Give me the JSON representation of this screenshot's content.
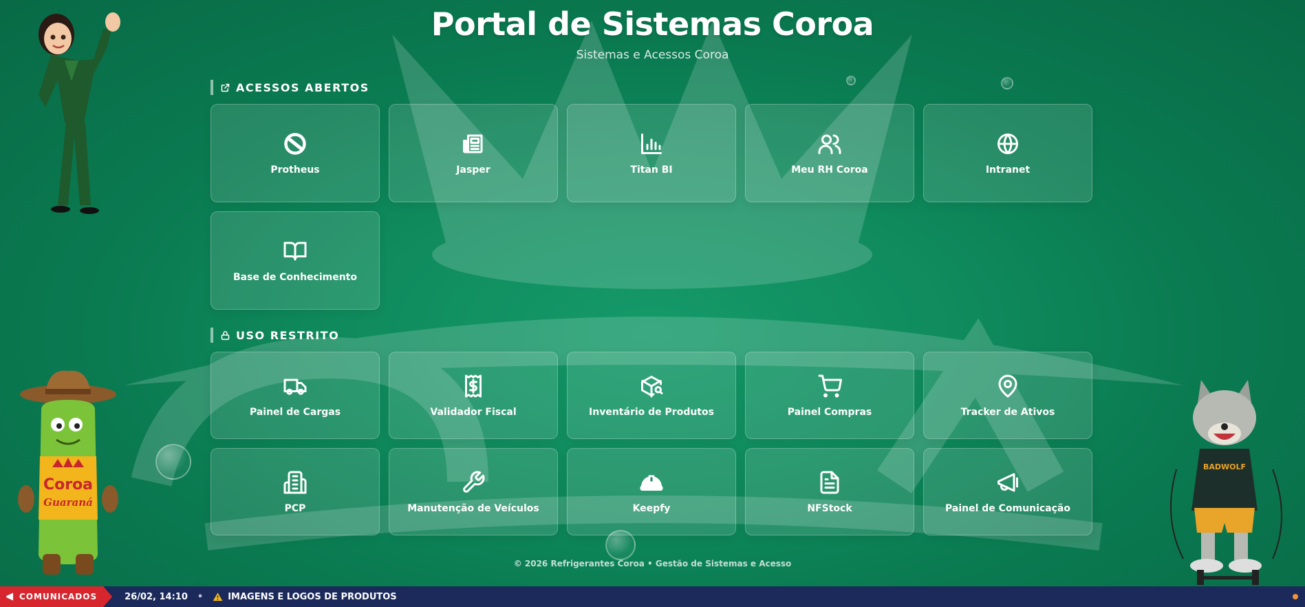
{
  "header": {
    "title": "Portal de Sistemas Coroa",
    "subtitle": "Sistemas e Acessos Coroa"
  },
  "sections": {
    "open": {
      "title": "ACESSOS ABERTOS",
      "icon": "external-link-icon",
      "items": [
        {
          "label": "Protheus",
          "icon": "protheus-logo-icon"
        },
        {
          "label": "Jasper",
          "icon": "newspaper-icon"
        },
        {
          "label": "Titan BI",
          "icon": "bar-chart-icon"
        },
        {
          "label": "Meu RH Coroa",
          "icon": "users-icon"
        },
        {
          "label": "Intranet",
          "icon": "globe-icon"
        },
        {
          "label": "Base de Conhecimento",
          "icon": "book-open-icon"
        }
      ]
    },
    "restricted": {
      "title": "USO RESTRITO",
      "icon": "lock-icon",
      "items": [
        {
          "label": "Painel de Cargas",
          "icon": "truck-icon"
        },
        {
          "label": "Validador Fiscal",
          "icon": "receipt-icon"
        },
        {
          "label": "Inventário de Produtos",
          "icon": "package-search-icon"
        },
        {
          "label": "Painel Compras",
          "icon": "shopping-cart-icon"
        },
        {
          "label": "Tracker de Ativos",
          "icon": "map-pin-icon"
        },
        {
          "label": "PCP",
          "icon": "factory-icon"
        },
        {
          "label": "Manutenção de Veículos",
          "icon": "wrench-icon"
        },
        {
          "label": "Keepfy",
          "icon": "hard-hat-icon"
        },
        {
          "label": "NFStock",
          "icon": "file-text-icon"
        },
        {
          "label": "Painel de Comunicação",
          "icon": "megaphone-icon"
        }
      ]
    }
  },
  "footer": {
    "text": "© 2026 Refrigerantes Coroa • Gestão de Sistemas e Acesso"
  },
  "ticker": {
    "badge": "COMUNICADOS",
    "time": "26/02, 14:10",
    "separator": "•",
    "message": "IMAGENS E LOGOS DE PRODUTOS",
    "message_icon": "warning-icon"
  },
  "mascots": {
    "bottle_brand": "Coroa",
    "bottle_sub": "Guaraná",
    "wolf_shirt": "BADWOLF"
  },
  "colors": {
    "background": "#0f8a5d",
    "ticker_bg": "#1b2a5a",
    "badge_red": "#d8262f",
    "status_orange": "#f4943a"
  }
}
